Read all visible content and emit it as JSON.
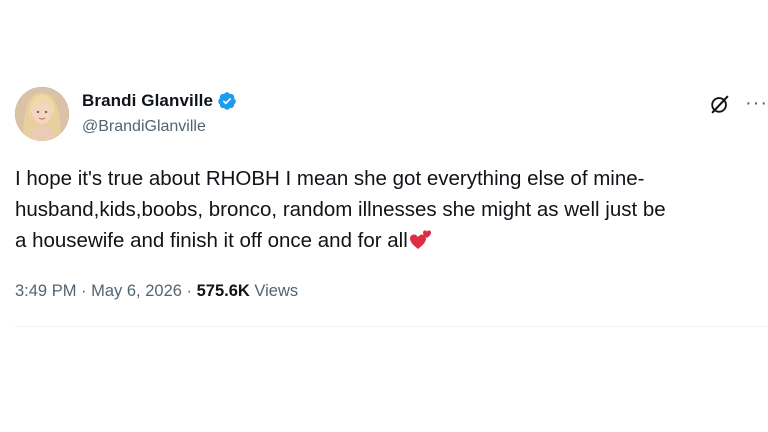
{
  "tweet": {
    "author": {
      "display_name": "Brandi Glanville",
      "handle": "@BrandiGlanville",
      "verified": true
    },
    "text_lines": [
      "I hope it's true about RHOBH I mean she got everything else of mine-",
      "husband,kids,boobs, bronco, random illnesses she might as well just be",
      "a housewife and finish it off once and for all"
    ],
    "emoji": "two-hearts-emoji",
    "timestamp": {
      "time": "3:49 PM",
      "separator": " · ",
      "date": "May 6, 2026",
      "separator2": " · ",
      "views_count": "575.6K",
      "views_label": " Views"
    },
    "actions": {
      "more": "···"
    }
  },
  "colors": {
    "primary_text": "#0f1419",
    "secondary_text": "#536471",
    "verified_blue": "#1d9bf0",
    "divider": "#eff3f4"
  }
}
